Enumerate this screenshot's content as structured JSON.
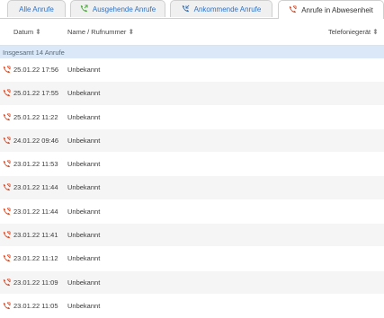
{
  "tabs": [
    {
      "label": "Alle Anrufe",
      "icon": "none",
      "active": false
    },
    {
      "label": "Ausgehende Anrufe",
      "icon": "outgoing-call-icon",
      "active": false
    },
    {
      "label": "Ankommende Anrufe",
      "icon": "incoming-call-icon",
      "active": false
    },
    {
      "label": "Anrufe in Abwesenheit",
      "icon": "missed-call-icon",
      "active": true
    }
  ],
  "columns": {
    "date": "Datum",
    "name": "Name / Rufnummer",
    "device": "Telefoniegerät"
  },
  "summary": "Insgesamt 14 Anrufe",
  "colors": {
    "missed_icon": "#e2471f",
    "outgoing_icon": "#4ca53b",
    "incoming_icon": "#2f72c4",
    "summary_bg": "#dae8f7"
  },
  "calls": [
    {
      "date": "25.01.22 17:56",
      "name": "Unbekannt"
    },
    {
      "date": "25.01.22 17:55",
      "name": "Unbekannt"
    },
    {
      "date": "25.01.22 11:22",
      "name": "Unbekannt"
    },
    {
      "date": "24.01.22 09:46",
      "name": "Unbekannt"
    },
    {
      "date": "23.01.22 11:53",
      "name": "Unbekannt"
    },
    {
      "date": "23.01.22 11:44",
      "name": "Unbekannt"
    },
    {
      "date": "23.01.22 11:44",
      "name": "Unbekannt"
    },
    {
      "date": "23.01.22 11:41",
      "name": "Unbekannt"
    },
    {
      "date": "23.01.22 11:12",
      "name": "Unbekannt"
    },
    {
      "date": "23.01.22 11:09",
      "name": "Unbekannt"
    },
    {
      "date": "23.01.22 11:05",
      "name": "Unbekannt"
    }
  ]
}
